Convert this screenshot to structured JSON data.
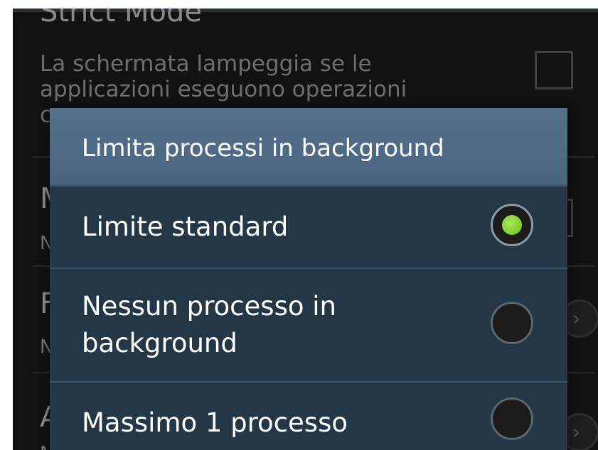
{
  "background": {
    "setting_title": "Strict Mode",
    "setting_description": "La schermata lampeggia se le applicazioni eseguono operazioni",
    "partial_letters": [
      "c",
      "M",
      "N",
      "F",
      "N",
      "A",
      "N"
    ]
  },
  "dialog": {
    "title": "Limita processi in background",
    "options": [
      {
        "label": "Limite standard",
        "selected": true
      },
      {
        "label": "Nessun processo in background",
        "selected": false
      },
      {
        "label": "Massimo 1 processo",
        "selected": false
      }
    ]
  },
  "colors": {
    "dialog_background": "#233746",
    "header_background": "#4f6b84",
    "selected_radio": "#7ed321"
  }
}
